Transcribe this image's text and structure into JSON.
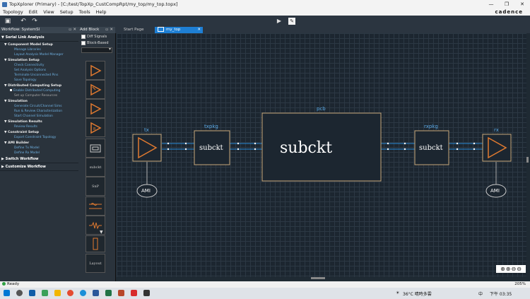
{
  "title_bar": {
    "text": "TopXplorer (Primary) - [C:/test/TopXp_CustCompRpt/my_top/my_top.topx]"
  },
  "menu": {
    "items": [
      "Topology",
      "Edit",
      "View",
      "Setup",
      "Tools",
      "Help"
    ],
    "brand": "cadence"
  },
  "workflow_panel": {
    "title": "Workflow: SystemSI",
    "sections": [
      {
        "label": "Serial Link Analysis"
      },
      {
        "label": "Component Model Setup"
      },
      {
        "label": "Manage Libraries"
      },
      {
        "label": "Layout Analysis Model Manager"
      },
      {
        "label": "Simulation Setup"
      },
      {
        "label": "Check Connectivity"
      },
      {
        "label": "Set Analysis Options"
      },
      {
        "label": "Terminate Unconnected Pins"
      },
      {
        "label": "Save Topology"
      },
      {
        "label": "Distributed Computing Setup"
      },
      {
        "label": "Enable Distributed Computing"
      },
      {
        "label": "Set up Computer Resources"
      },
      {
        "label": "Simulation"
      },
      {
        "label": "Generate Circuit/Channel Sims"
      },
      {
        "label": "Run & Review Characterization"
      },
      {
        "label": "Start Channel Simulation"
      },
      {
        "label": "Simulation Results"
      },
      {
        "label": "Review Results"
      },
      {
        "label": "Constraint Setup"
      },
      {
        "label": "Export Constraint Topology"
      },
      {
        "label": "AMI Builder"
      },
      {
        "label": "Define Tx Model"
      },
      {
        "label": "Define Rx Model"
      },
      {
        "label": "Switch Workflow"
      },
      {
        "label": "Customize Workflow"
      }
    ]
  },
  "add_block_panel": {
    "title": "Add Block",
    "diff_signals": "Diff Signals",
    "block_based": "Block-Based",
    "blocks": [
      "subckt",
      "SnP",
      "Layout"
    ]
  },
  "tabs": [
    "Start Page",
    "my_top"
  ],
  "canvas": {
    "pcb_label": "pcb",
    "pcb_text": "subckt",
    "tx_label": "tx",
    "rx_label": "rx",
    "txpkg_label": "txpkg",
    "rxpkg_label": "rxpkg",
    "txpkg_text": "subckt",
    "rxpkg_text": "subckt",
    "ami_left": "AMI",
    "ami_right": "AMI"
  },
  "status": {
    "text": "Ready",
    "zoom": "205%"
  },
  "taskbar": {
    "weather": "36°C 晴時多雲",
    "lang": "中",
    "time": "下午 03:35"
  },
  "colors": {
    "accent_tab": "#1e7fd4",
    "wire": "#2a8ad6",
    "block_border": "#c8a87a",
    "icon": "#e07a30"
  }
}
